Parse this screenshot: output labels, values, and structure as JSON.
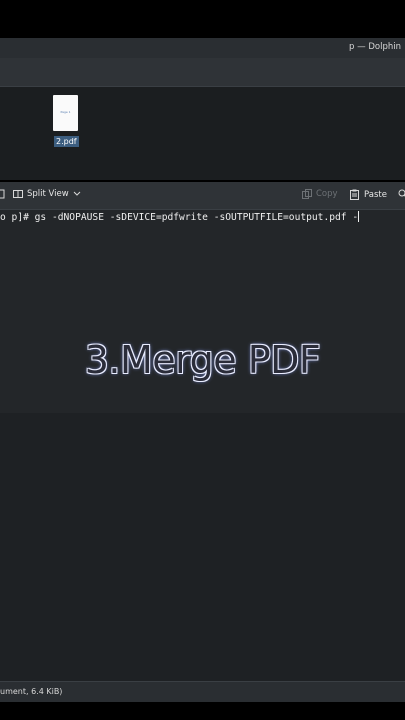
{
  "dolphin": {
    "title": "p — Dolphin",
    "file": {
      "name": "2.pdf",
      "thumb_text": "Page 1"
    }
  },
  "konsole": {
    "toolbar": {
      "split_view_label": "Split View",
      "copy_label": "Copy",
      "paste_label": "Paste"
    },
    "terminal_line": "o p]# gs -dNOPAUSE -sDEVICE=pdfwrite -sOUTPUTFILE=output.pdf -"
  },
  "overlay": {
    "text": "3.Merge PDF"
  },
  "statusbar": {
    "text": "ument, 6.4 KiB)"
  },
  "colors": {
    "selection": "#3c5e80",
    "terminal_bg": "#232629",
    "chrome": "#2f3337"
  }
}
